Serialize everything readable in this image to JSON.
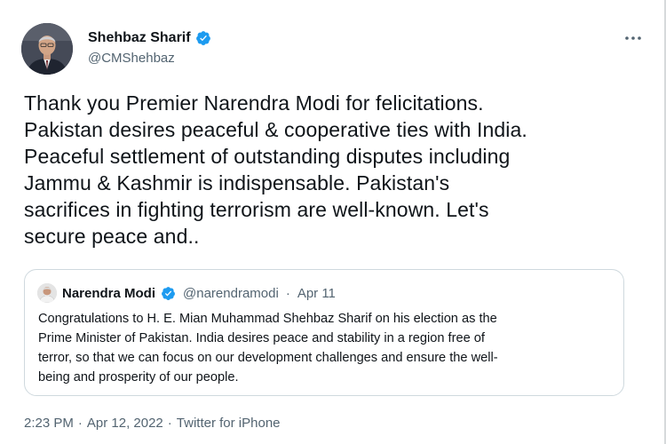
{
  "tweet": {
    "author_name": "Shehbaz Sharif",
    "author_handle": "@CMShehbaz",
    "verified_icon": "verified-badge-icon",
    "more_icon": "more-horizontal-icon",
    "text": "Thank you Premier Narendra Modi for felicitations.\nPakistan desires peaceful & cooperative ties with India.\nPeaceful settlement of outstanding disputes including\nJammu & Kashmir is indispensable. Pakistan's\nsacrifices in fighting terrorism are well-known. Let's\nsecure peace and..",
    "quoted": {
      "author_name": "Narendra Modi",
      "author_handle": "@narendramodi",
      "separator": "·",
      "date": "Apr 11",
      "text": "Congratulations to H. E. Mian Muhammad Shehbaz Sharif on his election as the\nPrime Minister of Pakistan. India desires peace and stability in a region free of\nterror, so that we can focus on our development challenges and ensure the well-\nbeing and prosperity of our people."
    },
    "footer": {
      "time": "2:23 PM",
      "separator1": "·",
      "date": "Apr 12, 2022",
      "separator2": "·",
      "source": "Twitter for iPhone"
    }
  },
  "colors": {
    "verified_blue": "#1d9bf0",
    "text_primary": "#0f1419",
    "text_secondary": "#536471",
    "border": "#cfd9de"
  }
}
